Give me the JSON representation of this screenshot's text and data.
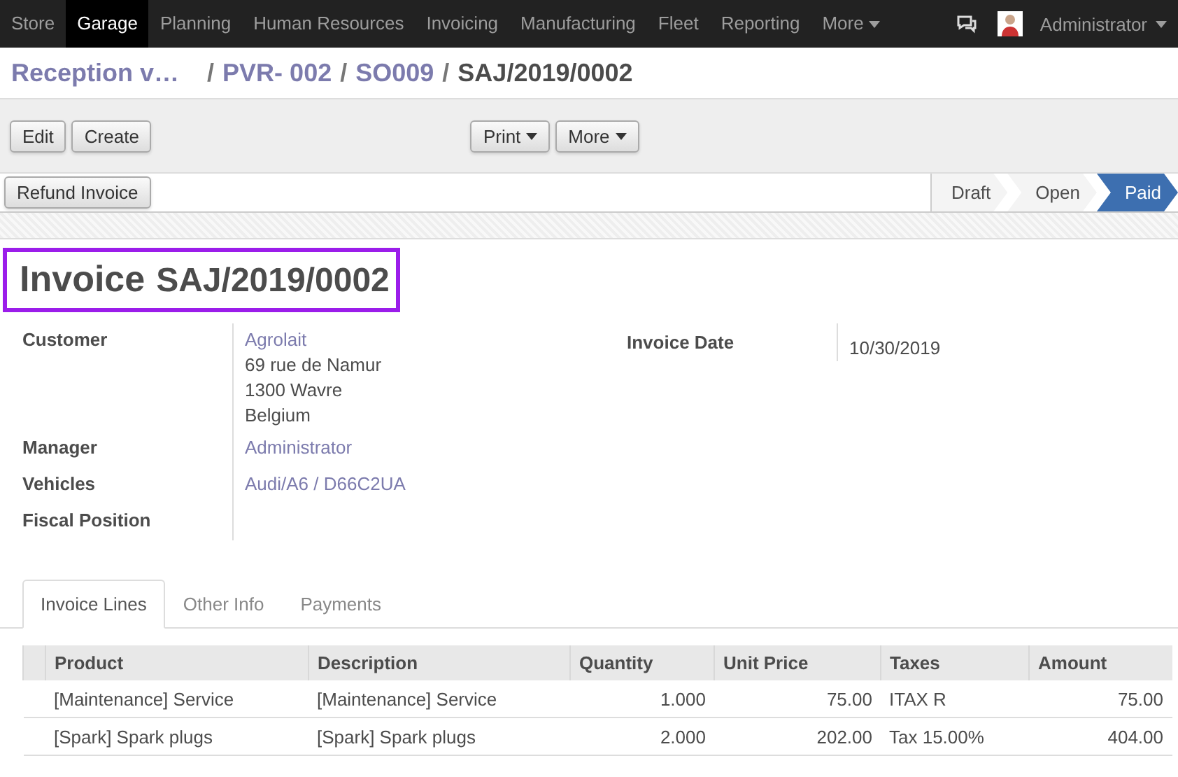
{
  "menu": [
    {
      "label": "Store",
      "selected": false
    },
    {
      "label": "Garage",
      "selected": true
    },
    {
      "label": "Planning",
      "selected": false
    },
    {
      "label": "Human Resources",
      "selected": false
    },
    {
      "label": "Invoicing",
      "selected": false
    },
    {
      "label": "Manufacturing",
      "selected": false
    },
    {
      "label": "Fleet",
      "selected": false
    },
    {
      "label": "Reporting",
      "selected": false
    },
    {
      "label": "More",
      "selected": false
    }
  ],
  "user": {
    "name": "Administrator"
  },
  "breadcrumb": [
    {
      "label": "Reception v…"
    },
    {
      "separator": "/",
      "label": "PVR- 002"
    },
    {
      "separator": "/",
      "label": "SO009"
    },
    {
      "separator": "/",
      "label": "SAJ/2019/0002"
    }
  ],
  "toolbar": {
    "left": [
      "Edit",
      "Create"
    ],
    "dropdowns": [
      "Print",
      "More"
    ]
  },
  "statusbar": {
    "buttons": [
      "Refund Invoice"
    ],
    "stages": [
      {
        "label": "Draft",
        "selected": false
      },
      {
        "label": "Open",
        "selected": false
      },
      {
        "label": "Paid",
        "selected": true
      }
    ]
  },
  "title": {
    "prefix": "Invoice",
    "number": "SAJ/2019/0002"
  },
  "left_fields": [
    {
      "label": "Customer",
      "lines": [
        "Agrolait",
        "69 rue de Namur",
        "1300 Wavre",
        "Belgium"
      ]
    },
    {
      "label": "Manager",
      "lines": [
        "Administrator"
      ]
    },
    {
      "label": "Vehicles",
      "lines": [
        "Audi/A6 / D66C2UA"
      ]
    },
    {
      "label": "Fiscal Position"
    }
  ],
  "right_fields": [
    {
      "label": "Invoice Date",
      "value": "10/30/2019"
    }
  ],
  "tabs": [
    {
      "label": "Invoice Lines",
      "selected": true
    },
    {
      "label": "Other Info",
      "selected": false
    },
    {
      "label": "Payments",
      "selected": false
    }
  ],
  "table": {
    "columns": [
      "Product",
      "Description",
      "Quantity",
      "Unit Price",
      "Taxes",
      "Amount"
    ],
    "rows": [
      [
        "[Maintenance] Service",
        "[Maintenance] Service",
        "1.000",
        "75.00",
        "ITAX R",
        "75.00"
      ],
      [
        "[Spark] Spark plugs",
        "[Spark] Spark plugs",
        "2.000",
        "202.00",
        "Tax 15.00%",
        "404.00"
      ]
    ]
  }
}
